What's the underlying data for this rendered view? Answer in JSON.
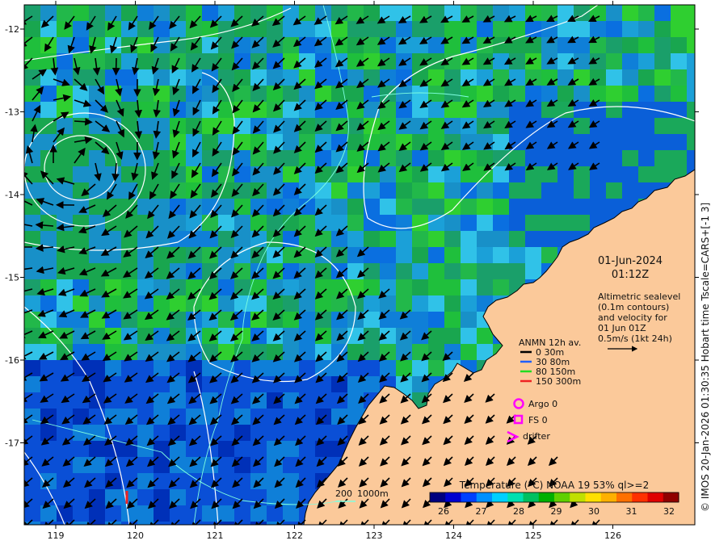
{
  "map": {
    "lon_ticks": [
      "119",
      "120",
      "121",
      "122",
      "123",
      "124",
      "125",
      "126"
    ],
    "lat_ticks": [
      "-12",
      "-13",
      "-14",
      "-15",
      "-16",
      "-17"
    ],
    "date": "01-Jun-2024",
    "time": "01:12Z",
    "note_lines": [
      "Altimetric sealevel",
      "(0.1m contours)",
      "and velocity for",
      "01 Jun 01Z",
      "0.5m/s (1kt 24h)"
    ],
    "anmn": {
      "title": "ANMN 12h av.",
      "items": [
        {
          "label": "0 30m",
          "color": "#000000"
        },
        {
          "label": "30 80m",
          "color": "#1f5fff"
        },
        {
          "label": "80 150m",
          "color": "#22dd22"
        },
        {
          "label": "150 300m",
          "color": "#ee2222"
        }
      ]
    },
    "symbols": [
      {
        "label": "Argo 0",
        "shape": "circle",
        "color": "#ff00ff"
      },
      {
        "label": "FS 0",
        "shape": "square",
        "color": "#ff00ff"
      },
      {
        "label": "drifter",
        "shape": "chevron",
        "color": "#ff00ff"
      }
    ],
    "depth_legend": [
      "200",
      "1000m"
    ],
    "colorbar": {
      "title": "Temperature (°C) NOAA 19 53% ql>=2",
      "ticks": [
        "26",
        "27",
        "28",
        "29",
        "30",
        "31",
        "32"
      ],
      "colors": [
        "#00007f",
        "#0000d0",
        "#0040ff",
        "#0090ff",
        "#00d0ff",
        "#00e0b0",
        "#00c060",
        "#00b000",
        "#60d000",
        "#c0e000",
        "#ffe000",
        "#ffb000",
        "#ff7000",
        "#ff3000",
        "#e00000",
        "#900000"
      ]
    },
    "side_label": "© IMOS 20-Jan-2026 01:30:35 Hobart time Tscale=CARS+[-1 3]"
  }
}
